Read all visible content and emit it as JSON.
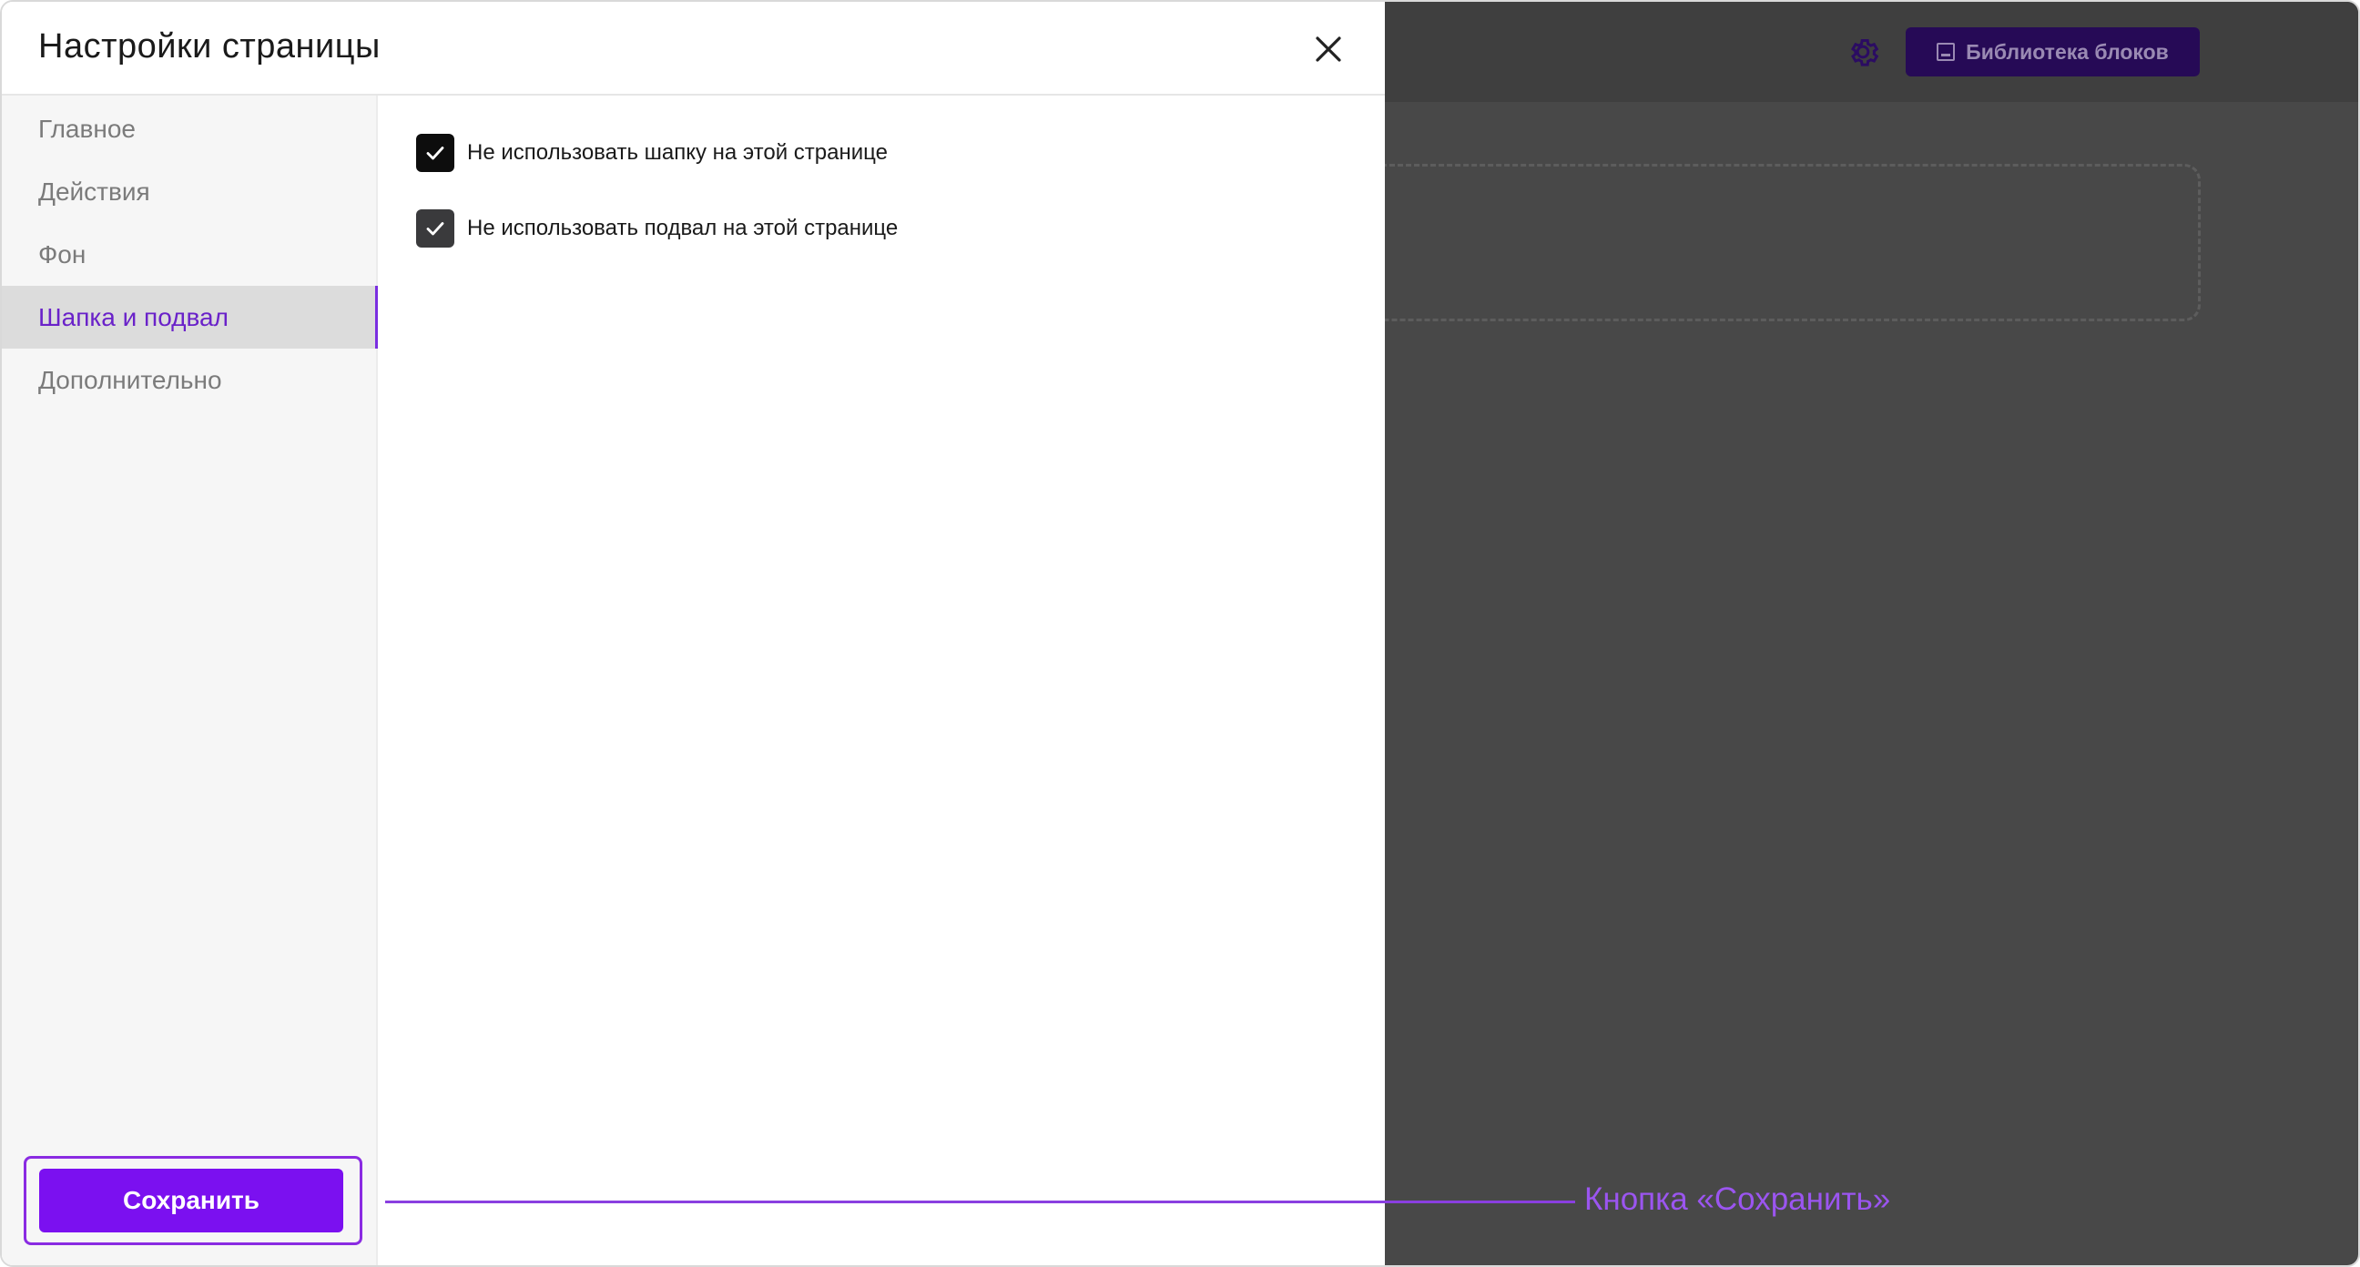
{
  "modal": {
    "title": "Настройки страницы"
  },
  "sidebar": {
    "items": [
      {
        "label": "Главное",
        "active": false
      },
      {
        "label": "Действия",
        "active": false
      },
      {
        "label": "Фон",
        "active": false
      },
      {
        "label": "Шапка и подвал",
        "active": true
      },
      {
        "label": "Дополнительно",
        "active": false
      }
    ],
    "save_label": "Сохранить"
  },
  "content": {
    "options": [
      {
        "label": "Не использовать шапку на этой странице",
        "checked": true
      },
      {
        "label": "Не использовать подвал на этой странице",
        "checked": true
      }
    ]
  },
  "editor": {
    "library_label": "Библиотека блоков"
  },
  "annotation": {
    "text": "Кнопка «Сохранить»"
  },
  "icons": {
    "close": "close-icon",
    "gear": "gear-icon",
    "library": "library-icon",
    "check": "check-icon"
  },
  "colors": {
    "accent": "#7b10f0",
    "active_text": "#6a22c9",
    "backdrop": "#484848",
    "library_button": "#260a56",
    "annotation": "#9b55f0"
  }
}
